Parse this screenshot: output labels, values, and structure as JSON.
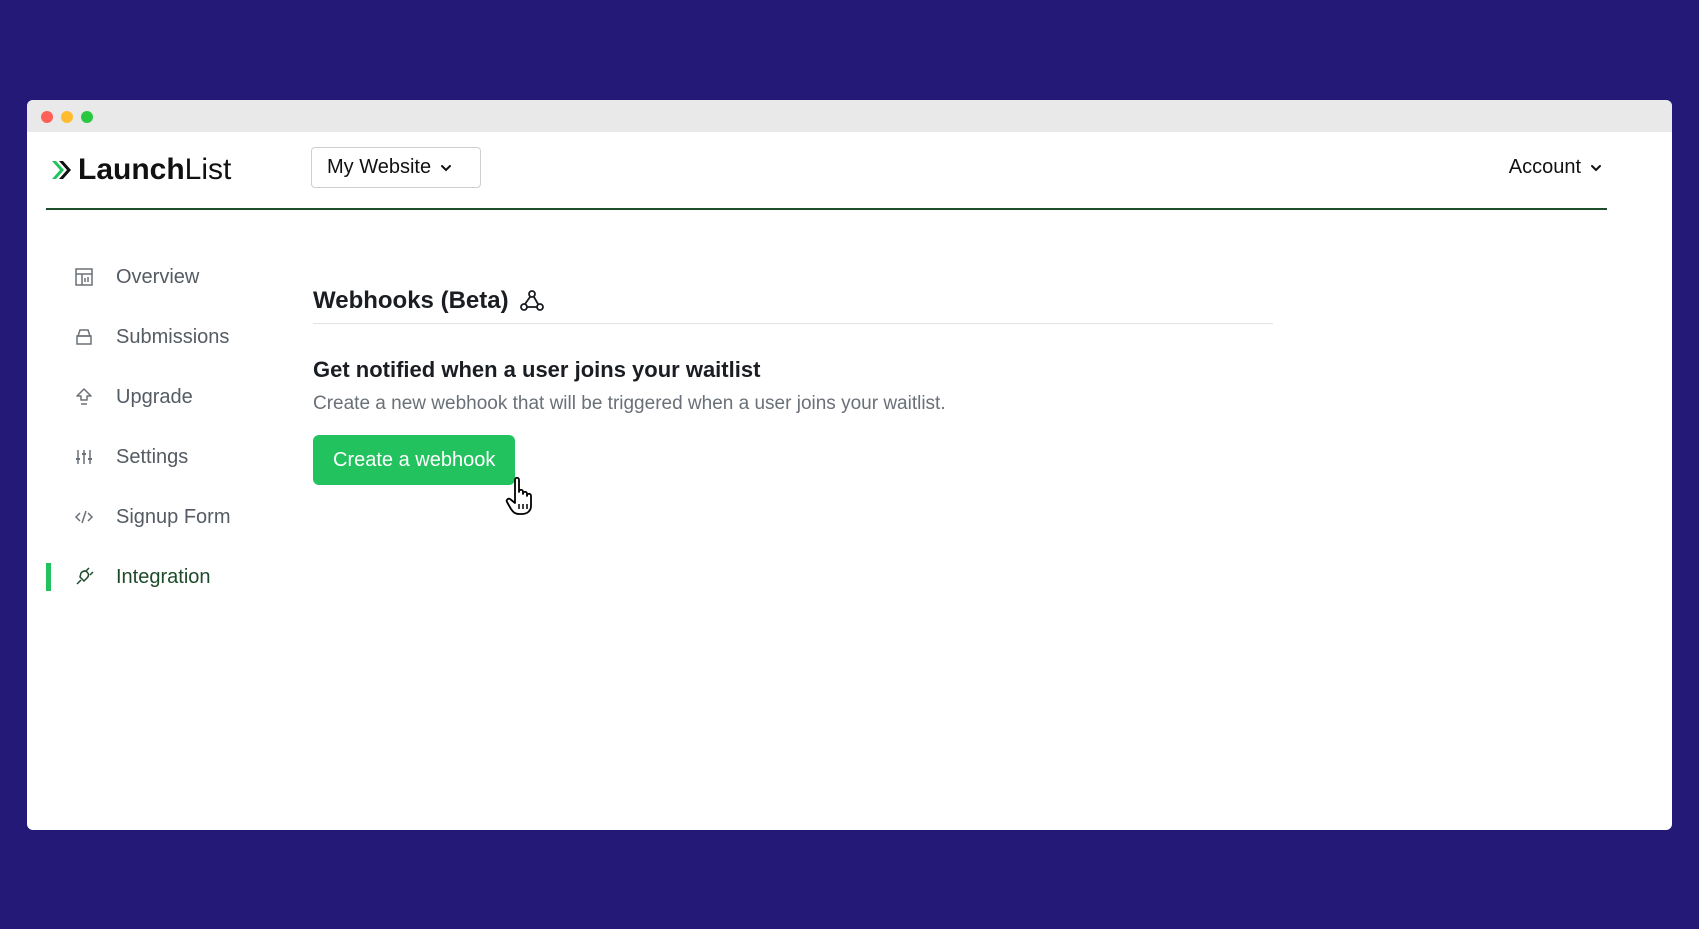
{
  "app": {
    "logo_bold": "Launch",
    "logo_light": "List",
    "site_selector": "My Website",
    "account_label": "Account",
    "accent_color": "#22c35e",
    "background_color": "#241977"
  },
  "sidebar": {
    "items": [
      {
        "label": "Overview",
        "icon": "chart-calendar-icon"
      },
      {
        "label": "Submissions",
        "icon": "inbox-icon"
      },
      {
        "label": "Upgrade",
        "icon": "arrow-up-icon"
      },
      {
        "label": "Settings",
        "icon": "sliders-icon"
      },
      {
        "label": "Signup Form",
        "icon": "code-icon"
      },
      {
        "label": "Integration",
        "icon": "plug-icon",
        "active": true
      }
    ]
  },
  "main": {
    "title": "Webhooks (Beta)",
    "title_icon": "webhook-icon",
    "subheading": "Get notified when a user joins your waitlist",
    "description": "Create a new webhook that will be triggered when a user joins your waitlist.",
    "button_label": "Create a webhook"
  }
}
